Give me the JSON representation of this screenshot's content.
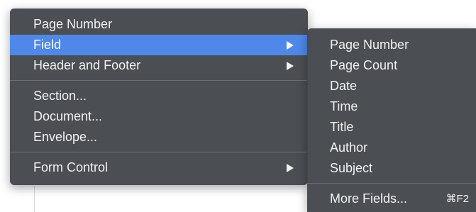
{
  "main_menu": {
    "page_number": "Page Number",
    "field": "Field",
    "header_footer": "Header and Footer",
    "section": "Section...",
    "document": "Document...",
    "envelope": "Envelope...",
    "form_control": "Form Control"
  },
  "submenu": {
    "page_number": "Page Number",
    "page_count": "Page Count",
    "date": "Date",
    "time": "Time",
    "title": "Title",
    "author": "Author",
    "subject": "Subject",
    "more_fields": "More Fields...",
    "more_fields_shortcut": "⌘F2"
  },
  "icons": {
    "submenu_arrow": "triangle-right-icon"
  },
  "colors": {
    "menu_background": "#44474c",
    "highlight": "#4f88e8",
    "text": "#f2f2f2",
    "separator": "#6b6e73"
  }
}
